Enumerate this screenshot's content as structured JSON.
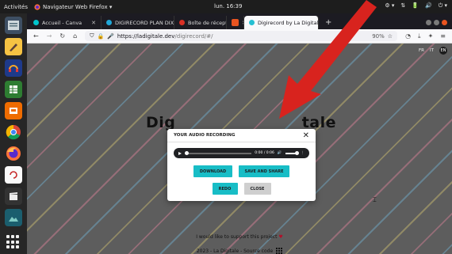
{
  "topbar": {
    "activities": "Activités",
    "app_name": "Navigateur Web Firefox ▾",
    "clock": "lun. 16:39",
    "tray": [
      "⚙ ▾",
      "⇅",
      "🔋",
      "🔊",
      "⏻ ▾"
    ]
  },
  "dock": {
    "items": [
      "files-icon",
      "text-editor-icon",
      "headphones-icon",
      "spreadsheet-icon",
      "slides-icon",
      "chrome-icon",
      "firefox-icon",
      "screenshot-icon",
      "clapper-icon",
      "landscape-icon"
    ],
    "show_apps": "show-applications-icon"
  },
  "browser": {
    "tabs": [
      {
        "label": "Accueil - Canva",
        "color": "#00c4cc",
        "active": false
      },
      {
        "label": "DIGIRECORD PLAN DIXIT",
        "color": "#20a7d8",
        "active": false
      },
      {
        "label": "Boîte de réception",
        "color": "#d93025",
        "active": false
      },
      {
        "label": "",
        "color": "#e95420",
        "active": false
      },
      {
        "label": "Digirecord by La Digitale",
        "color": "#26c0d3",
        "active": true
      }
    ],
    "new_tab": "+",
    "url_host": "https://ladigitale.dev",
    "url_path": "/digirecord/#/",
    "zoom": "90%"
  },
  "page": {
    "lang": [
      "FR",
      "IT",
      "EN"
    ],
    "title_left": "Dig",
    "title_right": "tale",
    "support_text": "I would like to support this project",
    "credits_text": "2023 - La Digitale - Source code"
  },
  "modal": {
    "title": "YOUR AUDIO RECORDING",
    "close": "✕",
    "time": "0:00 / 0:06",
    "progress": 0,
    "volume": 1,
    "download": "DOWNLOAD",
    "save_share": "SAVE AND SHARE",
    "redo": "REDO",
    "close_btn": "CLOSE"
  },
  "colors": {
    "accent": "#18bdc6",
    "arrow": "#d8231e",
    "ubuntu_orange": "#e95420"
  }
}
